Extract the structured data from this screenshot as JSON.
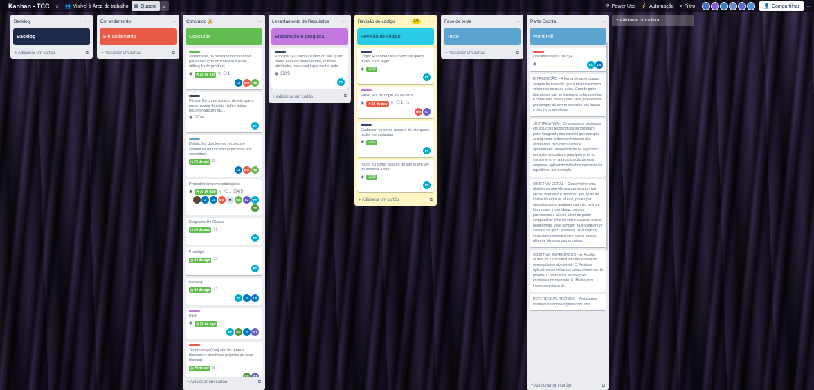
{
  "topbar": {
    "title": "Kanban - TCC",
    "star": "☆",
    "visibility_icon": "👥",
    "visibility": "Visível à Área de trabalho",
    "view_icon": "▦",
    "view": "Quadro",
    "view_chevron": "⌄",
    "powerups_icon": "⚲",
    "powerups": "Power-Ups",
    "automation_icon": "⚡",
    "automation": "Automação",
    "filter_icon": "≡",
    "filter": "Filtro",
    "share_icon": "👤",
    "share": "Compartilhar",
    "more": "···"
  },
  "lists": [
    {
      "title": "Backlog",
      "menu": "···",
      "banner": "Backlog",
      "banner_color": "#1e2a4a",
      "banner_text_color": "#ffffff",
      "add": "+ Adicionar um cartão",
      "add_icon": "⧉"
    },
    {
      "title": "Em andamento",
      "menu": "···",
      "banner": "Em andamento",
      "banner_color": "#eb5a46",
      "banner_text_color": "#ffffff",
      "add": "+ Adicionar um cartão",
      "add_icon": "⧉"
    },
    {
      "title": "Concluído 🎉",
      "menu": "···",
      "banner": "Concluído",
      "banner_color": "#61bd4f",
      "banner_text_color": "#ffffff",
      "add": "+ Adicionar um cartão",
      "add_icon": "⧉",
      "cards": [
        {
          "label_color": "#61bd4f",
          "text": "Listar todos os recursos necessários para execução do trabalho e para utilização do produto;",
          "eye": "◉",
          "due": "26 de set",
          "due_color": "g",
          "desc": "≡",
          "comments": "1",
          "avatars": [
            {
              "t": "LS",
              "c": "#0079bf"
            },
            {
              "t": "MO",
              "c": "#eb5a46"
            },
            {
              "t": "RB",
              "c": "#61bd4f"
            }
          ]
        },
        {
          "label_color": "#344563",
          "text": "Fórum: Eu como usuário do site quero poder postar duvidas, video aulas, recomendações etc...",
          "eye": "◉",
          "checklist_icon": "☑",
          "checklist": "0/4",
          "avatars": [
            {
              "t": "FT",
              "c": "#00aecc"
            }
          ]
        },
        {
          "label_color": "#5ba4cf",
          "text": "Definições dos termos técnicos e científicos (enunciado explicativo dos conceitos);",
          "due": "29 de set",
          "due_color": "g",
          "desc": "≡",
          "avatars": [
            {
              "t": "LS",
              "c": "#0079bf"
            },
            {
              "t": "MO",
              "c": "#eb5a46"
            },
            {
              "t": "RB",
              "c": "#61bd4f"
            }
          ]
        },
        {
          "text": "Procedimentos metodológicos",
          "eye": "◉",
          "due": "30 de ago",
          "due_color": "g",
          "desc": "≡",
          "comments": "1",
          "checklist_icon": "☑",
          "checklist": "4/5",
          "avatars": [
            {
              "t": "",
              "c": "#5a4632"
            },
            {
              "t": "J",
              "c": "#0079bf"
            },
            {
              "t": "LS",
              "c": "#0079bf"
            },
            {
              "t": "MO",
              "c": "#eb5a46"
            },
            {
              "t": "M",
              "c": "#dfe1e6"
            },
            {
              "t": "RB",
              "c": "#61bd4f"
            },
            {
              "t": "SJ",
              "c": "#6e5dc6"
            },
            {
              "t": "FT",
              "c": "#00aecc"
            },
            {
              "t": "GS",
              "c": "#519839"
            }
          ]
        },
        {
          "text": "Diagrama De Classe",
          "due": "24 de ago",
          "due_color": "g",
          "attach": "1",
          "avatars": [
            {
              "t": "FT",
              "c": "#00aecc"
            }
          ]
        },
        {
          "text": "Protótipo",
          "due": "24 de ago",
          "due_color": "g",
          "attach": "3",
          "avatars": [
            {
              "t": "FT",
              "c": "#00aecc"
            }
          ]
        },
        {
          "text": "Backlog",
          "due": "24 de ago",
          "due_color": "g",
          "attach": "1",
          "avatars": [
            {
              "t": "FT",
              "c": "#00aecc"
            },
            {
              "t": "J",
              "c": "#0079bf"
            },
            {
              "t": "LS",
              "c": "#0079bf"
            }
          ]
        },
        {
          "label_color": "#c377e0",
          "text": "Pitch",
          "eye": "◉",
          "due": "17 de ago",
          "due_color": "g",
          "avatars": [
            {
              "t": "FT",
              "c": "#00aecc"
            },
            {
              "t": "GS",
              "c": "#519839"
            },
            {
              "t": "J",
              "c": "#0079bf"
            },
            {
              "t": "SJ",
              "c": "#6e5dc6"
            }
          ]
        },
        {
          "label_color": "#eb5a46",
          "text": "Terminologia(conjunto de termos técnicos e científicos próprios da área técnica);",
          "due": "29 de set",
          "due_color": "g",
          "desc": "≡",
          "avatars": [
            {
              "t": "GS",
              "c": "#519839"
            },
            {
              "t": "SJ",
              "c": "#6e5dc6"
            }
          ]
        }
      ]
    },
    {
      "title": "Levantamento de Requisitos",
      "menu": "···",
      "banner": "Elaboração e pesquisa",
      "banner_color": "#c377e0",
      "banner_text_color": "#172b4d",
      "add": "+ Adicionar um cartão",
      "add_icon": "⧉",
      "cards": [
        {
          "label_color": "#344563",
          "text": "Principal: Eu como usuário do site quero poder acessar minha turma, minhas atividades, meu ranking e minha nota",
          "eye": "◉",
          "checklist_icon": "☑",
          "checklist": "0/5",
          "avatars": [
            {
              "t": "FT",
              "c": "#00aecc"
            }
          ]
        }
      ]
    },
    {
      "title": "Revisão de código",
      "badge": "3/3",
      "menu": "···",
      "banner": "Revisão de código",
      "banner_color": "#29cce5",
      "banner_text_color": "#172b4d",
      "add": "+ Adicionar um cartão",
      "add_icon": "⧉",
      "cards": [
        {
          "label_color": "#344563",
          "text": "Login: Eu como usuário do site quero poder fazer login",
          "eye": "◉",
          "chk": "3/3",
          "avatars": [
            {
              "t": "FT",
              "c": "#00aecc"
            }
          ]
        },
        {
          "label_color": "#c377e0",
          "text": "Fazer tela de Login e Cadastro",
          "eye": "◉",
          "due": "29 de ago",
          "due_color": "r",
          "desc": "≡",
          "comments": "1",
          "attach": "1",
          "avatars": [
            {
              "t": "MO",
              "c": "#eb5a46"
            },
            {
              "t": "SJ",
              "c": "#6e5dc6"
            }
          ]
        },
        {
          "label_color": "#344563",
          "text": "Cadastro: eu como usuário do site quero poder me cadastrar",
          "eye": "◉",
          "chk": "5/5",
          "avatars": [
            {
              "t": "FT",
              "c": "#00aecc"
            }
          ]
        },
        {
          "text": "Inicio: eu como usuário do site quero ver ao acessar o site",
          "eye": "◉",
          "chk": "3/3",
          "avatars": [
            {
              "t": "FT",
              "c": "#00aecc"
            }
          ]
        }
      ]
    },
    {
      "title": "Fase de teste",
      "menu": "···",
      "banner": "Teste",
      "banner_color": "#5ba4cf",
      "banner_text_color": "#ffffff",
      "add": "+ Adicionar um cartão",
      "add_icon": "⧉"
    },
    {
      "title": "Parte Escrita",
      "menu": "···",
      "banner": "Word/Pdf",
      "banner_color": "#5ba4cf",
      "banner_text_color": "#ffffff",
      "add": "+ Adicionar um cartão",
      "add_icon": "⧉",
      "doc": {
        "label_color": "#eb5a46",
        "text": "Documentação: Study+",
        "eye": "◉",
        "avatars": [
          {
            "t": "FT",
            "c": "#00aecc"
          },
          {
            "t": "LS",
            "c": "#0079bf"
          }
        ]
      },
      "texts": [
        "INTRODUÇÃO – A forma de aprendizado sempre foi maçante, por a dinâmica nunca existir nas salas de aulas. Grande parte dos alunos não se interessa pelas matérias e conteúdos dados pelos seus professores, por sempre só serem expostos nas lousas e nos livros escolares.",
        "JUSTIFICATIVA – Os processos baseados em soluções tecnológicas se tornaram parte integrante das escolas que desejam acompanhar o desenvolvimento dos estudantes com dificuldade de aprendizado. Independente do segmento, um sistema colabora principalmente no crescimento e na organização de uma empresa, agilizando trabalhos operacionais repetitivos, por exemplo.",
        "OBJETIVO GERAL – Desenvolver uma plataforma que ofereça um estudo mais eficaz, interativo e dinâmico que ajude na interação entre os alunos, pode upar apostilas sobre qualquer assunto, terá um fórum para trocar ideias com os professores e alunos, além de poder compartilhar links de vídeo aulas de outras plataformas, você também irá encontrar um sistema de quizz e ranking para disputar seus conhecimentos com outros alunos, além de diversas outras coisas.",
        "OBJETIVO ESPECÍFICOS – A. Auxiliar alunos; B. Conceituar as dificuldades do nosso público alvo inicial; C. Analisar aplicativos semelhantes como referência do projeto; D. Requisitar as soluções existentes no mercado; E. Melhorar o interesse estudantil.",
        "REFERENCIAL TEÓRICO – Analisamos várias plataformas digitais com uma"
      ]
    }
  ],
  "add_list": "+ Adicionar outra lista"
}
